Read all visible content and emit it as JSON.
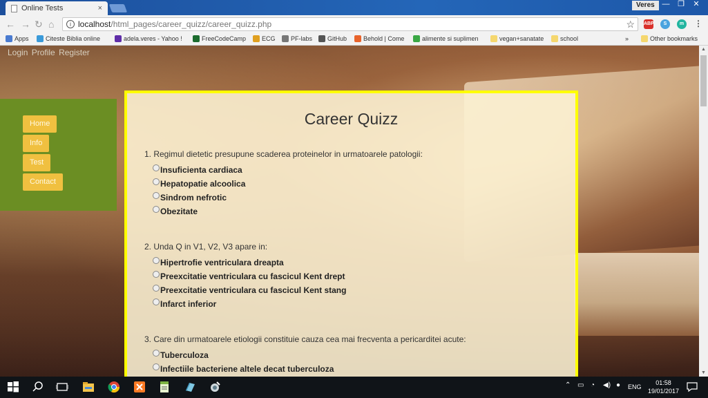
{
  "browser": {
    "tab_title": "Online Tests",
    "tab_close": "×",
    "user": "Veres",
    "window_buttons": [
      "—",
      "❐",
      "✕"
    ],
    "url_host": "localhost",
    "url_path": "/html_pages/career_quizz/career_quizz.php",
    "bookmarks": [
      {
        "label": "Apps",
        "color": "#4a7bd0"
      },
      {
        "label": "Citeste Biblia online",
        "color": "#3a9ad9"
      },
      {
        "label": "adela.veres - Yahoo !",
        "color": "#5f2da8"
      },
      {
        "label": "FreeCodeCamp",
        "color": "#1c6b2e"
      },
      {
        "label": "ECG",
        "color": "#e0a020"
      },
      {
        "label": "PF-labs",
        "color": "#777777"
      },
      {
        "label": "GitHub",
        "color": "#555555"
      },
      {
        "label": "Behold | Come",
        "color": "#e8632b"
      },
      {
        "label": "alimente si suplimen",
        "color": "#3aa845"
      },
      {
        "label": "vegan+sanatate",
        "color": "#f5d76e"
      },
      {
        "label": "school",
        "color": "#f5d76e"
      },
      {
        "label": "»",
        "color": ""
      },
      {
        "label": "Other bookmarks",
        "color": "#f5d76e"
      }
    ]
  },
  "page": {
    "top_links": [
      "Login",
      "Profile",
      "Register"
    ],
    "nav": [
      "Home",
      "Info",
      "Test",
      "Contact"
    ],
    "quiz_title": "Career Quizz",
    "questions": [
      {
        "text": "1. Regimul dietetic presupune scaderea proteinelor in urmatoarele patologii:",
        "options": [
          "Insuficienta cardiaca",
          "Hepatopatie alcoolica",
          "Sindrom nefrotic",
          "Obezitate"
        ]
      },
      {
        "text": "2. Unda Q in V1, V2, V3 apare in:",
        "options": [
          "Hipertrofie ventriculara dreapta",
          "Preexcitatie ventriculara cu fascicul Kent drept",
          "Preexcitatie ventriculara cu fascicul Kent stang",
          "Infarct inferior"
        ]
      },
      {
        "text": "3. Care din urmatoarele etiologii constituie cauza cea mai frecventa a pericarditei acute:",
        "options": [
          "Tuberculoza",
          "Infectiile bacteriene altele decat tuberculoza"
        ]
      }
    ]
  },
  "taskbar": {
    "lang": "ENG",
    "time": "01:58",
    "date": "19/01/2017"
  }
}
